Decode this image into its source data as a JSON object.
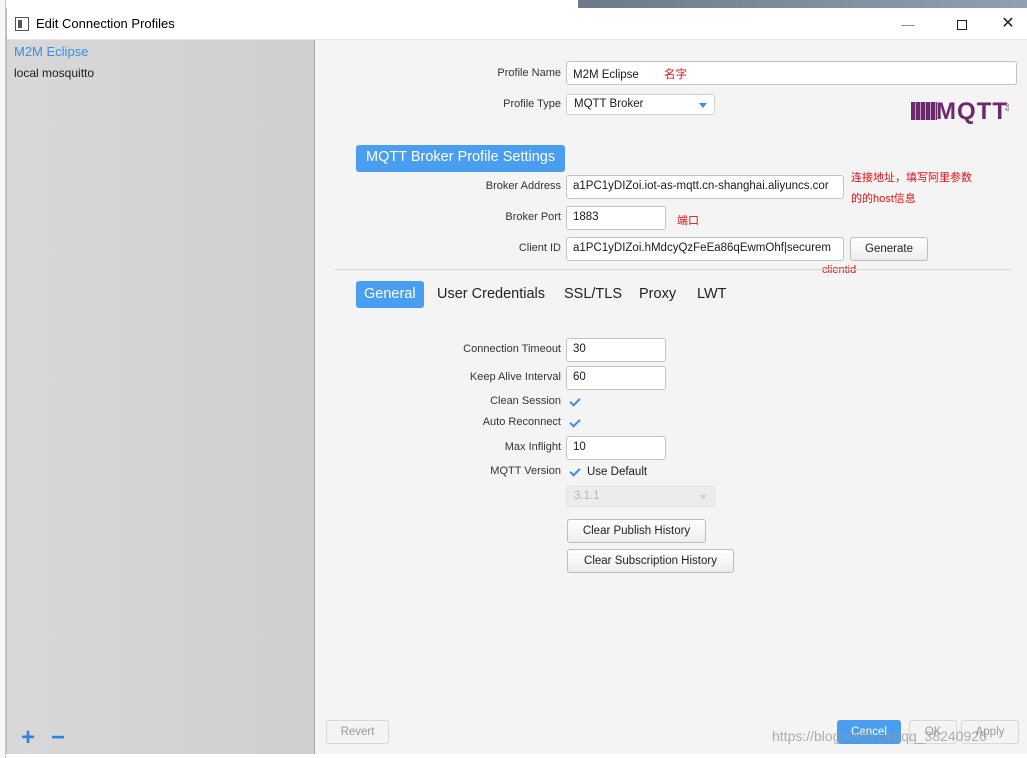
{
  "window": {
    "title": "Edit Connection Profiles",
    "minimize": "—",
    "close": "✕"
  },
  "sidebar": {
    "profiles": [
      "M2M Eclipse",
      "local mosquitto"
    ],
    "add": "+",
    "remove": "−"
  },
  "form": {
    "profile_name_label": "Profile Name",
    "profile_name": "M2M Eclipse",
    "profile_name_note": "名字",
    "profile_type_label": "Profile Type",
    "profile_type": "MQTT Broker",
    "logo_text": "MQTT",
    "logo_small": ".org",
    "section_header": "MQTT Broker Profile Settings",
    "broker_address_label": "Broker Address",
    "broker_address": "a1PC1yDIZoi.iot-as-mqtt.cn-shanghai.aliyuncs.cor",
    "broker_address_note_line1": "连接地址，填写阿里参数",
    "broker_address_note_line2": "的的host信息",
    "broker_port_label": "Broker Port",
    "broker_port": "1883",
    "broker_port_note": "端口",
    "client_id_label": "Client ID",
    "client_id": "a1PC1yDIZoi.hMdcyQzFeEa86qEwmOhf|securem",
    "client_id_note": "clientid",
    "generate": "Generate"
  },
  "tabs": [
    "General",
    "User Credentials",
    "SSL/TLS",
    "Proxy",
    "LWT"
  ],
  "general": {
    "connection_timeout_label": "Connection Timeout",
    "connection_timeout": "30",
    "keep_alive_label": "Keep Alive Interval",
    "keep_alive": "60",
    "clean_session_label": "Clean Session",
    "clean_session": true,
    "auto_reconnect_label": "Auto Reconnect",
    "auto_reconnect": true,
    "max_inflight_label": "Max Inflight",
    "max_inflight": "10",
    "mqtt_version_label": "MQTT Version",
    "use_default_label": "Use Default",
    "use_default": true,
    "mqtt_version": "3.1.1",
    "clear_publish": "Clear Publish History",
    "clear_subscription": "Clear Subscription History"
  },
  "footer": {
    "revert": "Revert",
    "cancel": "Cancel",
    "ok": "OK",
    "apply": "Apply"
  },
  "watermark": "https://blog.csdn.net/qq_38240926",
  "colors": {
    "accent": "#4a9ef0",
    "annotation": "#dd1111",
    "logo": "#6d2a6b"
  }
}
